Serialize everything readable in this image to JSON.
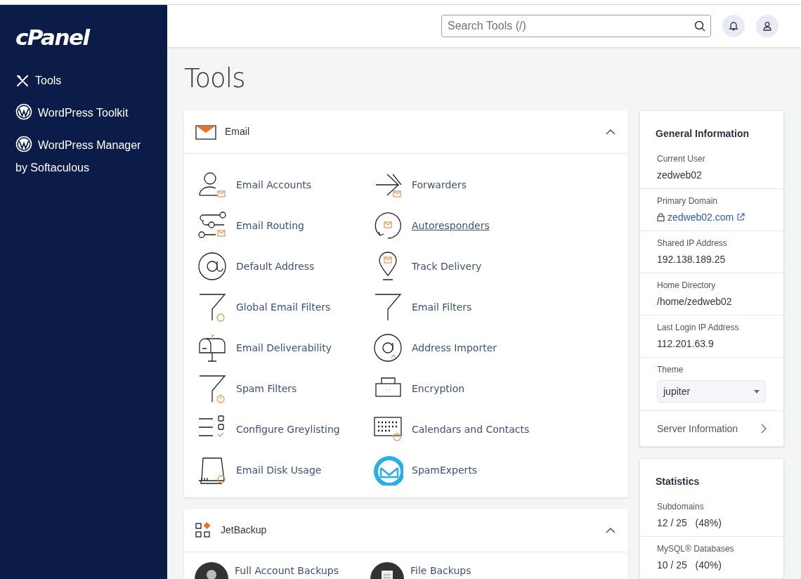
{
  "sidebar": {
    "logo": "cPanel",
    "items": [
      {
        "label": "Tools"
      },
      {
        "label": "WordPress Toolkit"
      },
      {
        "label": "WordPress Manager by Softaculous"
      }
    ]
  },
  "header": {
    "search": {
      "placeholder": "Search Tools (/)"
    }
  },
  "page_title": "Tools",
  "sections": [
    {
      "title": "Email",
      "expanded": true,
      "items": [
        {
          "label": "Email Accounts",
          "hovered": false
        },
        {
          "label": "Forwarders",
          "hovered": false
        },
        {
          "label": "Email Routing",
          "hovered": false
        },
        {
          "label": "Autoresponders",
          "hovered": true
        },
        {
          "label": "Default Address",
          "hovered": false
        },
        {
          "label": "Track Delivery",
          "hovered": false
        },
        {
          "label": "Global Email Filters",
          "hovered": false
        },
        {
          "label": "Email Filters",
          "hovered": false
        },
        {
          "label": "Email Deliverability",
          "hovered": false
        },
        {
          "label": "Address Importer",
          "hovered": false
        },
        {
          "label": "Spam Filters",
          "hovered": false
        },
        {
          "label": "Encryption",
          "hovered": false
        },
        {
          "label": "Configure Greylisting",
          "hovered": false
        },
        {
          "label": "Calendars and Contacts",
          "hovered": false
        },
        {
          "label": "Email Disk Usage",
          "hovered": false
        },
        {
          "label": "SpamExperts",
          "hovered": false
        }
      ]
    },
    {
      "title": "JetBackup",
      "expanded": true,
      "items": [
        {
          "label": "Full Account Backups",
          "hovered": false
        },
        {
          "label": "File Backups",
          "hovered": false
        }
      ]
    }
  ],
  "general_information": {
    "title": "General Information",
    "fields": [
      {
        "label": "Current User",
        "value": "zedweb02",
        "kind": "text"
      },
      {
        "label": "Primary Domain",
        "value": "zedweb02.com",
        "kind": "link"
      },
      {
        "label": "Shared IP Address",
        "value": "192.138.189.25",
        "kind": "text"
      },
      {
        "label": "Home Directory",
        "value": "/home/zedweb02",
        "kind": "text"
      },
      {
        "label": "Last Login IP Address",
        "value": "112.201.63.9",
        "kind": "text"
      },
      {
        "label": "Theme",
        "value": "jupiter",
        "kind": "select"
      }
    ],
    "link": "Server Information"
  },
  "statistics": {
    "title": "Statistics",
    "fields": [
      {
        "label": "Subdomains",
        "value": "12 / 25   (48%)"
      },
      {
        "label": "MySQL® Databases",
        "value": "10 / 25   (40%)"
      }
    ]
  }
}
